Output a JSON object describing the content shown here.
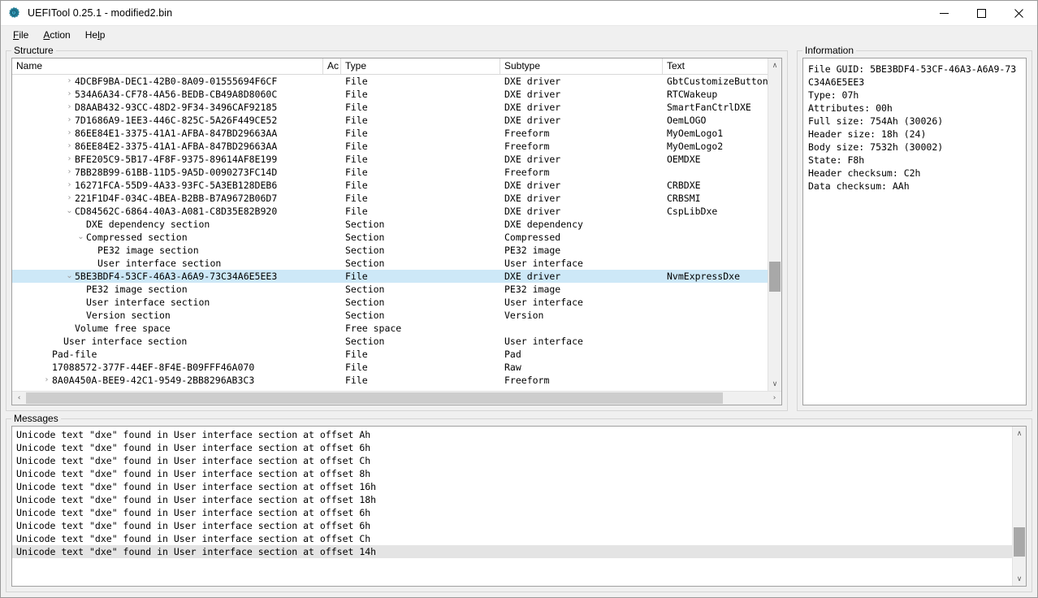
{
  "window": {
    "title": "UEFITool 0.25.1 - modified2.bin",
    "icon": "gear-icon",
    "minimize_label": "—",
    "maximize_label": "☐",
    "close_label": "✕"
  },
  "menu": {
    "items": [
      {
        "label": "File",
        "mnemonic": "F"
      },
      {
        "label": "Action",
        "mnemonic": "A"
      },
      {
        "label": "Help",
        "mnemonic": "l"
      }
    ]
  },
  "structure": {
    "title": "Structure",
    "columns": [
      {
        "key": "name",
        "label": "Name"
      },
      {
        "key": "ac",
        "label": "Ac"
      },
      {
        "key": "type",
        "label": "Type"
      },
      {
        "key": "subtype",
        "label": "Subtype"
      },
      {
        "key": "text",
        "label": "Text"
      }
    ],
    "rows": [
      {
        "indent": 4,
        "chev": "collapsed",
        "name": "4DCBF9BA-DEC1-42B0-8A09-01555694F6CF",
        "ac": "",
        "type": "File",
        "subtype": "DXE driver",
        "text": "GbtCustomizeButtonSmm",
        "selected": false
      },
      {
        "indent": 4,
        "chev": "collapsed",
        "name": "534A6A34-CF78-4A56-BEDB-CB49A8D8060C",
        "ac": "",
        "type": "File",
        "subtype": "DXE driver",
        "text": "RTCWakeup",
        "selected": false
      },
      {
        "indent": 4,
        "chev": "collapsed",
        "name": "D8AAB432-93CC-48D2-9F34-3496CAF92185",
        "ac": "",
        "type": "File",
        "subtype": "DXE driver",
        "text": "SmartFanCtrlDXE",
        "selected": false
      },
      {
        "indent": 4,
        "chev": "collapsed",
        "name": "7D1686A9-1EE3-446C-825C-5A26F449CE52",
        "ac": "",
        "type": "File",
        "subtype": "DXE driver",
        "text": "OemLOGO",
        "selected": false
      },
      {
        "indent": 4,
        "chev": "collapsed",
        "name": "86EE84E1-3375-41A1-AFBA-847BD29663AA",
        "ac": "",
        "type": "File",
        "subtype": "Freeform",
        "text": "MyOemLogo1",
        "selected": false
      },
      {
        "indent": 4,
        "chev": "collapsed",
        "name": "86EE84E2-3375-41A1-AFBA-847BD29663AA",
        "ac": "",
        "type": "File",
        "subtype": "Freeform",
        "text": "MyOemLogo2",
        "selected": false
      },
      {
        "indent": 4,
        "chev": "collapsed",
        "name": "BFE205C9-5B17-4F8F-9375-89614AF8E199",
        "ac": "",
        "type": "File",
        "subtype": "DXE driver",
        "text": "OEMDXE",
        "selected": false
      },
      {
        "indent": 4,
        "chev": "collapsed",
        "name": "7BB28B99-61BB-11D5-9A5D-0090273FC14D",
        "ac": "",
        "type": "File",
        "subtype": "Freeform",
        "text": "",
        "selected": false
      },
      {
        "indent": 4,
        "chev": "collapsed",
        "name": "16271FCA-55D9-4A33-93FC-5A3EB128DEB6",
        "ac": "",
        "type": "File",
        "subtype": "DXE driver",
        "text": "CRBDXE",
        "selected": false
      },
      {
        "indent": 4,
        "chev": "collapsed",
        "name": "221F1D4F-034C-4BEA-B2BB-B7A9672B06D7",
        "ac": "",
        "type": "File",
        "subtype": "DXE driver",
        "text": "CRBSMI",
        "selected": false
      },
      {
        "indent": 4,
        "chev": "expanded",
        "name": "CD84562C-6864-40A3-A081-C8D35E82B920",
        "ac": "",
        "type": "File",
        "subtype": "DXE driver",
        "text": "CspLibDxe",
        "selected": false
      },
      {
        "indent": 5,
        "chev": "none",
        "name": "DXE dependency section",
        "ac": "",
        "type": "Section",
        "subtype": "DXE dependency",
        "text": "",
        "selected": false
      },
      {
        "indent": 5,
        "chev": "expanded",
        "name": "Compressed section",
        "ac": "",
        "type": "Section",
        "subtype": "Compressed",
        "text": "",
        "selected": false
      },
      {
        "indent": 6,
        "chev": "none",
        "name": "PE32 image section",
        "ac": "",
        "type": "Section",
        "subtype": "PE32 image",
        "text": "",
        "selected": false
      },
      {
        "indent": 6,
        "chev": "none",
        "name": "User interface section",
        "ac": "",
        "type": "Section",
        "subtype": "User interface",
        "text": "",
        "selected": false
      },
      {
        "indent": 4,
        "chev": "expanded",
        "name": "5BE3BDF4-53CF-46A3-A6A9-73C34A6E5EE3",
        "ac": "",
        "type": "File",
        "subtype": "DXE driver",
        "text": "NvmExpressDxe",
        "selected": true
      },
      {
        "indent": 5,
        "chev": "none",
        "name": "PE32 image section",
        "ac": "",
        "type": "Section",
        "subtype": "PE32 image",
        "text": "",
        "selected": false
      },
      {
        "indent": 5,
        "chev": "none",
        "name": "User interface section",
        "ac": "",
        "type": "Section",
        "subtype": "User interface",
        "text": "",
        "selected": false
      },
      {
        "indent": 5,
        "chev": "none",
        "name": "Version section",
        "ac": "",
        "type": "Section",
        "subtype": "Version",
        "text": "",
        "selected": false
      },
      {
        "indent": 4,
        "chev": "none",
        "name": "Volume free space",
        "ac": "",
        "type": "Free space",
        "subtype": "",
        "text": "",
        "selected": false
      },
      {
        "indent": 3,
        "chev": "none",
        "name": "User interface section",
        "ac": "",
        "type": "Section",
        "subtype": "User interface",
        "text": "",
        "selected": false
      },
      {
        "indent": 2,
        "chev": "none",
        "name": "Pad-file",
        "ac": "",
        "type": "File",
        "subtype": "Pad",
        "text": "",
        "selected": false
      },
      {
        "indent": 2,
        "chev": "none",
        "name": "17088572-377F-44EF-8F4E-B09FFF46A070",
        "ac": "",
        "type": "File",
        "subtype": "Raw",
        "text": "",
        "selected": false
      },
      {
        "indent": 2,
        "chev": "collapsed",
        "name": "8A0A450A-BEE9-42C1-9549-2BB8296AB3C3",
        "ac": "",
        "type": "File",
        "subtype": "Freeform",
        "text": "",
        "selected": false
      }
    ]
  },
  "information": {
    "title": "Information",
    "body": "File GUID: 5BE3BDF4-53CF-46A3-A6A9-73C34A6E5EE3\nType: 07h\nAttributes: 00h\nFull size: 754Ah (30026)\nHeader size: 18h (24)\nBody size: 7532h (30002)\nState: F8h\nHeader checksum: C2h\nData checksum: AAh"
  },
  "messages": {
    "title": "Messages",
    "rows": [
      {
        "text": "Unicode text \"dxe\" found in User interface section at offset Ah",
        "selected": false
      },
      {
        "text": "Unicode text \"dxe\" found in User interface section at offset 6h",
        "selected": false
      },
      {
        "text": "Unicode text \"dxe\" found in User interface section at offset Ch",
        "selected": false
      },
      {
        "text": "Unicode text \"dxe\" found in User interface section at offset 8h",
        "selected": false
      },
      {
        "text": "Unicode text \"dxe\" found in User interface section at offset 16h",
        "selected": false
      },
      {
        "text": "Unicode text \"dxe\" found in User interface section at offset 18h",
        "selected": false
      },
      {
        "text": "Unicode text \"dxe\" found in User interface section at offset 6h",
        "selected": false
      },
      {
        "text": "Unicode text \"dxe\" found in User interface section at offset 6h",
        "selected": false
      },
      {
        "text": "Unicode text \"dxe\" found in User interface section at offset Ch",
        "selected": false
      },
      {
        "text": "Unicode text \"dxe\" found in User interface section at offset 14h",
        "selected": true
      }
    ]
  },
  "scrollbars": {
    "up_arrow": "∧",
    "down_arrow": "∨",
    "left_arrow": "‹",
    "right_arrow": "›"
  },
  "colors": {
    "selection": "#cde8f7",
    "msg_selection": "#e4e4e4",
    "window_bg": "#f0f0f0",
    "panel_bg": "#ffffff"
  }
}
